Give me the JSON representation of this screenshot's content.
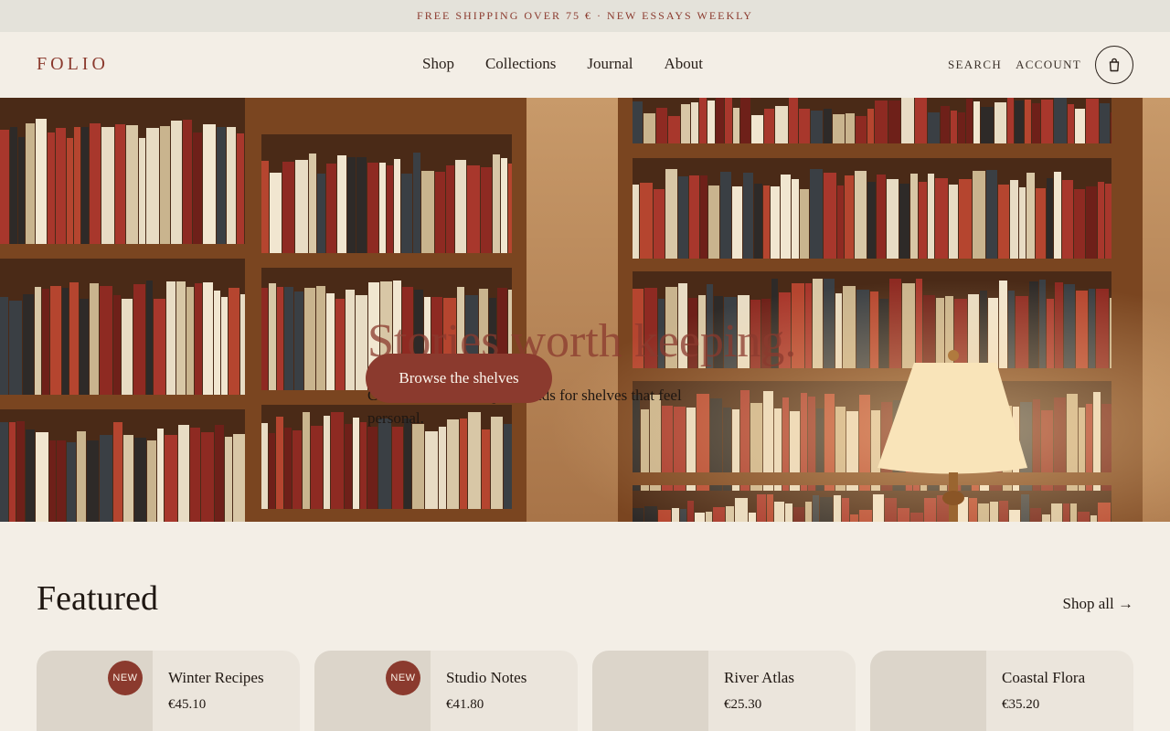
{
  "announcement": "FREE SHIPPING OVER 75 € · NEW ESSAYS WEEKLY",
  "header": {
    "logo": "FOLIO",
    "nav": [
      "Shop",
      "Collections",
      "Journal",
      "About"
    ],
    "search_label": "SEARCH",
    "account_label": "ACCOUNT",
    "cart_icon": "bag-icon"
  },
  "hero": {
    "title": "Stories worth keeping.",
    "subtitle": "Curated books and quiet reads for shelves that feel personal.",
    "cta": "Browse the shelves"
  },
  "featured": {
    "title": "Featured",
    "shop_all": "Shop all →",
    "products": [
      {
        "name": "Winter Recipes",
        "price": "€45.10",
        "badge": "NEW"
      },
      {
        "name": "Studio Notes",
        "price": "€41.80",
        "badge": "NEW"
      },
      {
        "name": "River Atlas",
        "price": "€25.30",
        "badge": ""
      },
      {
        "name": "Coastal Flora",
        "price": "€35.20",
        "badge": ""
      }
    ]
  },
  "colors": {
    "accent": "#8b3a2e",
    "background": "#f3eee6",
    "announcement_bg": "#e4e2da"
  }
}
